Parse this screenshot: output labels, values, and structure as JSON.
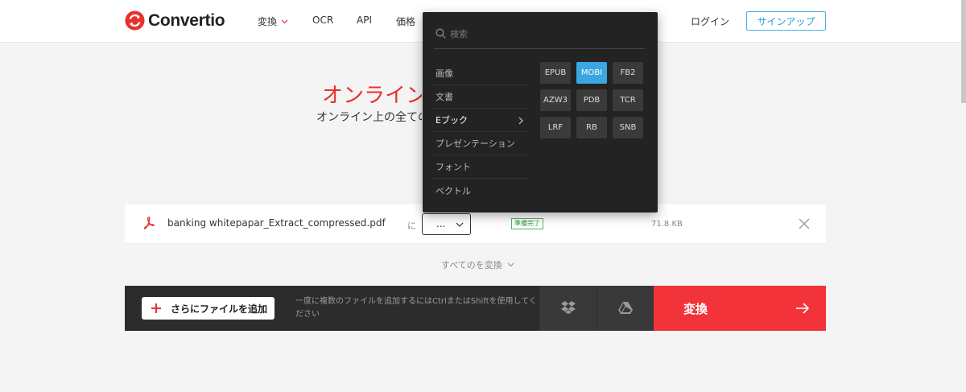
{
  "brand": {
    "name": "Convertio",
    "color": "#e8302e"
  },
  "nav": {
    "items": [
      {
        "label": "変換",
        "has_dropdown": true
      },
      {
        "label": "OCR"
      },
      {
        "label": "API"
      },
      {
        "label": "価格"
      }
    ],
    "login": "ログイン",
    "signup": "サインアップ"
  },
  "hero": {
    "title": "オンラインファイル変換ツール",
    "subtitle": "オンライン上の全てのファイルを変換"
  },
  "file": {
    "name": "banking whitepapar_Extract_compressed.pdf",
    "to_label": "に",
    "format_value": "...",
    "status": "準備完了",
    "size": "71.8 KB"
  },
  "convert_all": "すべてのを変換",
  "action_bar": {
    "add_files": "さらにファイルを追加",
    "hint": "一度に複数のファイルを追加するにはCtrlまたはShiftを使用してください",
    "convert": "変換"
  },
  "dropdown": {
    "search_placeholder": "検索",
    "categories": [
      {
        "label": "画像"
      },
      {
        "label": "文書"
      },
      {
        "label": "Eブック",
        "active": true
      },
      {
        "label": "プレゼンテーション"
      },
      {
        "label": "フォント"
      },
      {
        "label": "ベクトル"
      }
    ],
    "formats": [
      "EPUB",
      "MOBI",
      "FB2",
      "AZW3",
      "PDB",
      "TCR",
      "LRF",
      "RB",
      "SNB"
    ],
    "selected_format": "MOBI"
  },
  "colors": {
    "accent_red": "#f3333a",
    "accent_blue": "#3aa6e2",
    "ready_green": "#2a9d3a"
  }
}
